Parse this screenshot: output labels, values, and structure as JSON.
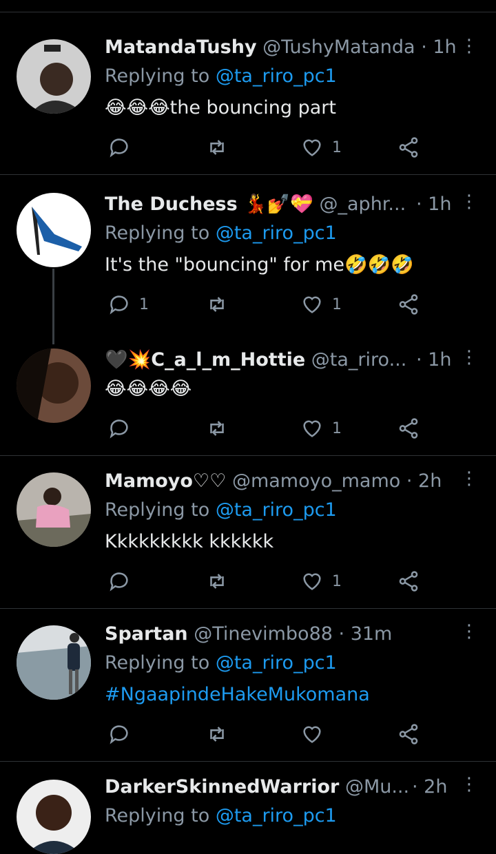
{
  "replying_to_label": "Replying to",
  "more_glyph": "⋮",
  "colors": {
    "background": "#000000",
    "text": "#e7e9ea",
    "muted": "#8b98a5",
    "link": "#1d9bf0",
    "divider": "#2f3336"
  },
  "tweets": [
    {
      "name": "MatandaTushy",
      "handle": "@TushyMatanda",
      "time": "· 1h",
      "replying_to": "@ta_riro_pc1",
      "text": "😂😂😂the bouncing part",
      "replies": "",
      "likes": "1",
      "avatar_icon": "user-photo-avatar"
    },
    {
      "name": "The Duchess 💃💅💝",
      "handle": "@_aphr...",
      "time": "· 1h",
      "replying_to": "@ta_riro_pc1",
      "text": "It's the \"bouncing\" for me🤣🤣🤣",
      "replies": "1",
      "likes": "1",
      "avatar_icon": "shoe-avatar"
    },
    {
      "name": "🖤💥C_a_l_m_Hottie",
      "handle": "@ta_riro...",
      "time": "· 1h",
      "replying_to": "",
      "text": "😂😂😂😂",
      "replies": "",
      "likes": "1",
      "avatar_icon": "user-photo-avatar"
    },
    {
      "name": "Mamoyo♡♡",
      "handle": "@mamoyo_mamo",
      "time": "· 2h",
      "replying_to": "@ta_riro_pc1",
      "text": "Kkkkkkkkk kkkkkk",
      "replies": "",
      "likes": "1",
      "avatar_icon": "user-photo-avatar"
    },
    {
      "name": "Spartan",
      "handle": "@Tinevimbo88",
      "time": "· 31m",
      "replying_to": "@ta_riro_pc1",
      "text": "#NgaapindeHakeMukomana",
      "replies": "",
      "likes": "",
      "avatar_icon": "user-photo-avatar"
    },
    {
      "name": "DarkerSkinnedWarrior",
      "handle": "@Mu...",
      "time": "· 2h",
      "replying_to": "@ta_riro_pc1",
      "text": "",
      "replies": "",
      "likes": "",
      "avatar_icon": "user-photo-avatar"
    }
  ]
}
